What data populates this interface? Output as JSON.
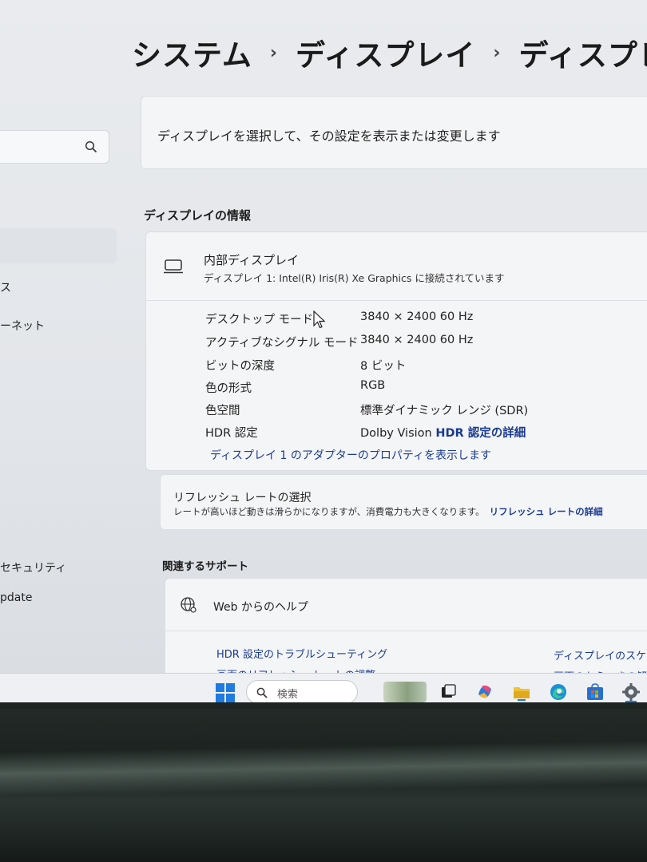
{
  "breadcrumb": {
    "items": [
      "システム",
      "ディスプレイ",
      "ディスプレイの詳細"
    ],
    "separator": "›"
  },
  "sidebar": {
    "search_icon": "search-icon",
    "items": [
      {
        "label": "ス"
      },
      {
        "label": "ーネット"
      },
      {
        "label": "セキュリティ"
      },
      {
        "label": "pdate"
      }
    ]
  },
  "description": "ディスプレイを選択して、その設定を表示または変更します",
  "display_info": {
    "section_title": "ディスプレイの情報",
    "icon": "monitor-icon",
    "name": "内部ディスプレイ",
    "subtitle": "ディスプレイ 1: Intel(R) Iris(R) Xe Graphics に接続されています",
    "rows": [
      {
        "label": "デスクトップ モード",
        "value": "3840 × 2400 60 Hz"
      },
      {
        "label": "アクティブなシグナル モード",
        "value": "3840 × 2400 60 Hz"
      },
      {
        "label": "ビットの深度",
        "value": "8 ビット"
      },
      {
        "label": "色の形式",
        "value": "RGB"
      },
      {
        "label": "色空間",
        "value": "標準ダイナミック レンジ (SDR)"
      },
      {
        "label": "HDR 認定",
        "value": "Dolby Vision",
        "link": "HDR 認定の詳細"
      }
    ],
    "adapter_link": "ディスプレイ 1 のアダプターのプロパティを表示します"
  },
  "refresh": {
    "title": "リフレッシュ レートの選択",
    "subtitle": "レートが高いほど動きは滑らかになりますが、消費電力も大きくなります。",
    "link": "リフレッシュ レートの詳細"
  },
  "support": {
    "section_title": "関連するサポート",
    "icon": "globe-icon",
    "label": "Web からのヘルプ",
    "links": [
      "HDR 設定のトラブルシューティング",
      "ディスプレイのスケーリ",
      "画面のリフレッシュ レートの調整",
      "画面のちらつきの解"
    ]
  },
  "taskbar": {
    "search_placeholder": "検索",
    "icons": [
      "windows-start-icon",
      "search-icon",
      "widgets-icon",
      "task-view-icon",
      "copilot-icon",
      "file-explorer-icon",
      "edge-icon",
      "store-icon",
      "settings-icon"
    ]
  },
  "colors": {
    "accent": "#1a3b8f",
    "windows_blue": "#1f7be0"
  }
}
